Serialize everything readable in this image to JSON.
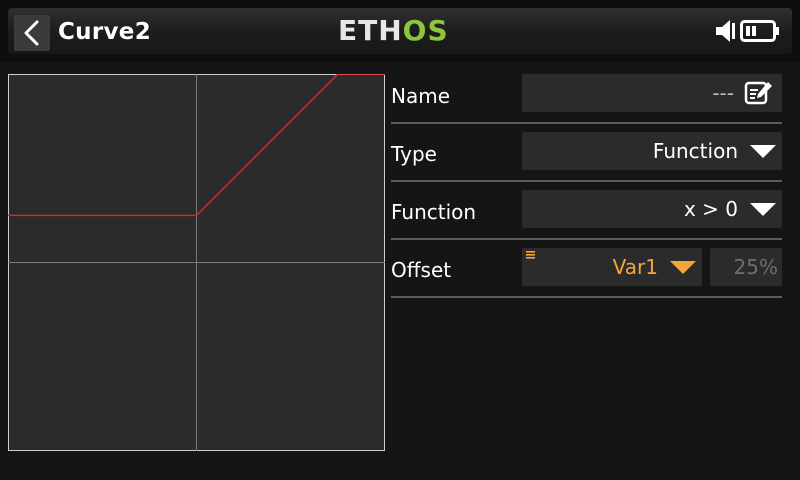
{
  "header": {
    "title": "Curve2",
    "logo_part1": "ETH",
    "logo_part2": "OS"
  },
  "fields": {
    "name": {
      "label": "Name",
      "value": "---"
    },
    "type": {
      "label": "Type",
      "value": "Function"
    },
    "function": {
      "label": "Function",
      "value": "x > 0"
    },
    "offset": {
      "label": "Offset",
      "source": "Var1",
      "value": "25%"
    }
  },
  "colors": {
    "accent": "#f4a53a",
    "logo_green": "#8cc63f",
    "curve": "#d9262b",
    "field_bg": "#2b2b2b"
  },
  "curve": {
    "x_range": [
      -100,
      100
    ],
    "y_range": [
      -100,
      100
    ],
    "points": [
      [
        -100,
        25
      ],
      [
        0,
        25
      ],
      [
        75,
        100
      ],
      [
        100,
        100
      ]
    ]
  }
}
